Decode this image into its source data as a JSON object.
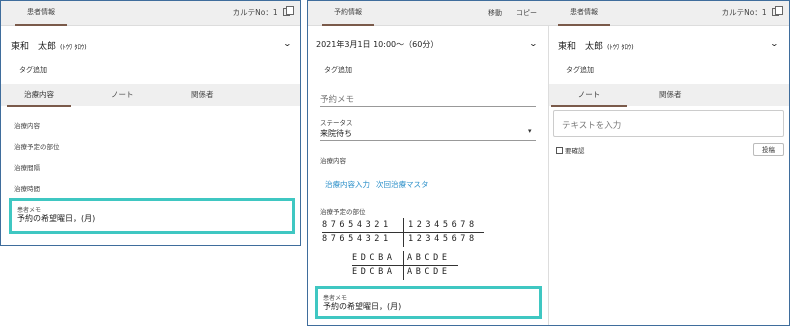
{
  "left_panel": {
    "tab": "患者情報",
    "karte": "カルテNo：1",
    "patient_name": "東和　太郎",
    "patient_kana": "(ﾄｳﾜ ﾀﾛｳ)",
    "tag_add": "タグ追加",
    "subtabs": [
      "治療内容",
      "ノート",
      "関係者"
    ],
    "fields": [
      "治療内容",
      "治療予定の部位",
      "治療間隔",
      "治療時間"
    ],
    "memo_label": "患者メモ",
    "memo_value": "予約の希望曜日，(月)"
  },
  "middle_panel": {
    "tab": "予約情報",
    "move": "移動",
    "copy": "コピー",
    "datetime": "2021年3月1日 10:00〜（60分）",
    "tag_add": "タグ追加",
    "memo_placeholder": "予約メモ",
    "status_label": "ステータス",
    "status_value": "来院待ち",
    "treatment_label": "治療内容",
    "link_input": "治療内容入力",
    "link_next": "次回治療マスタ",
    "site_label": "治療予定の部位",
    "teeth_left": "87654321",
    "teeth_right": "12345678",
    "primary_left": "EDCBA",
    "primary_right": "ABCDE",
    "memo_label": "患者メモ",
    "memo_value": "予約の希望曜日，(月)"
  },
  "right_panel": {
    "tab": "患者情報",
    "karte": "カルテNo：1",
    "patient_name": "東和　太郎",
    "patient_kana": "(ﾄｳﾜ ﾀﾛｳ)",
    "tag_add": "タグ追加",
    "subtabs": [
      "ノート",
      "関係者"
    ],
    "text_placeholder": "テキストを入力",
    "confirm_label": "要確認",
    "post_button": "投稿"
  },
  "icons": {
    "copy": "copy-icon",
    "chevron": "chevron-down-icon"
  },
  "colors": {
    "highlight": "#3fc7c2",
    "link": "#2a8fc9",
    "border": "#3f6d9c"
  }
}
